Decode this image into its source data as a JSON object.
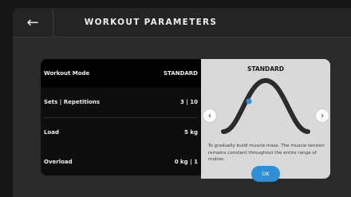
{
  "header": {
    "title": "WORKOUT PARAMETERS",
    "back_icon": "←"
  },
  "parameters": [
    {
      "label": "Workout Mode",
      "value": "STANDARD"
    },
    {
      "label": "Sets | Repetitions",
      "value": "3 | 10"
    },
    {
      "label": "Load",
      "value": "5 kg"
    },
    {
      "label": "Overload",
      "value": "0 kg | 1"
    }
  ],
  "mode_panel": {
    "title": "STANDARD",
    "description": "To gradually build muscle mass. The muscle tension remains constant throughout the entire range of motion.",
    "prev_icon": "‹",
    "next_icon": "›",
    "ok_label": "OK"
  },
  "colors": {
    "accent": "#2f8fd6",
    "background": "#161616",
    "panel": "#d9d9d9"
  }
}
